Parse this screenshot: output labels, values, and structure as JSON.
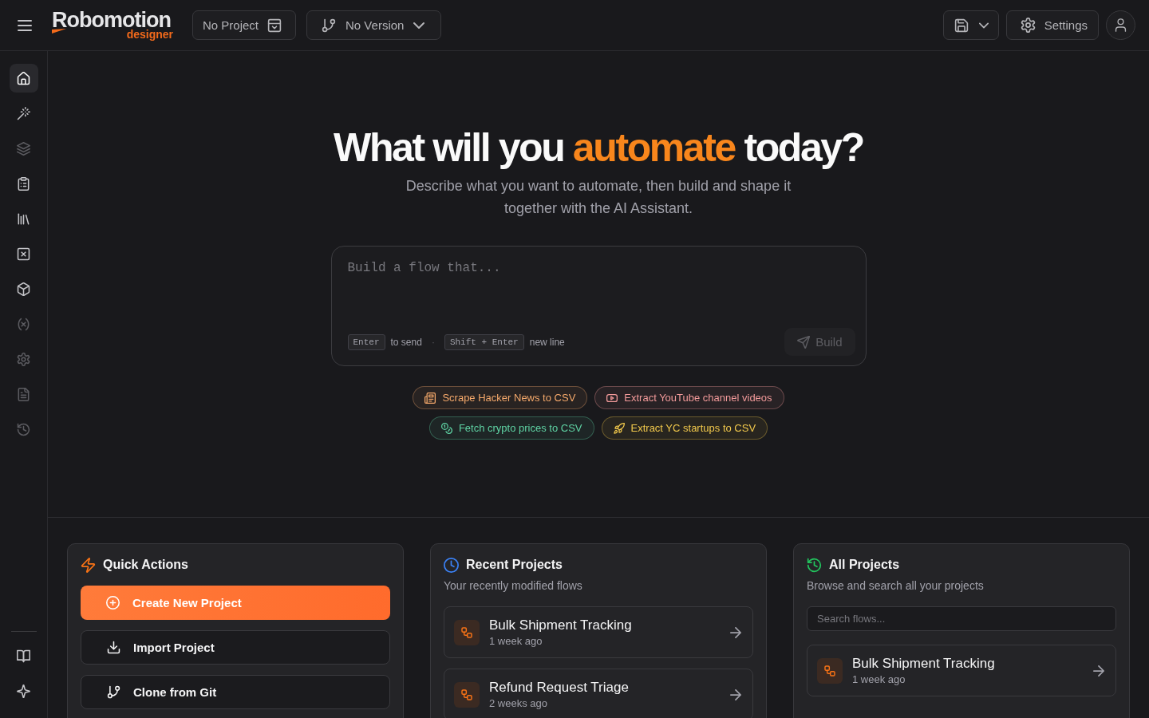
{
  "top_bar": {
    "wordmark": "Robomotion",
    "tagline": "designer",
    "project_picker": "No Project",
    "version_picker": "No Version",
    "settings_label": "Settings"
  },
  "sidebar": {
    "items": [
      {
        "selected": true,
        "disabled": false
      },
      {
        "selected": false,
        "disabled": false
      },
      {
        "selected": false,
        "disabled": true
      },
      {
        "selected": false,
        "disabled": false
      },
      {
        "selected": false,
        "disabled": false
      },
      {
        "selected": false,
        "disabled": false
      },
      {
        "selected": false,
        "disabled": false
      },
      {
        "selected": false,
        "disabled": true
      },
      {
        "selected": false,
        "disabled": true
      },
      {
        "selected": false,
        "disabled": true
      },
      {
        "selected": false,
        "disabled": true
      }
    ]
  },
  "hero": {
    "title": {
      "before": "What will you ",
      "highlight": "automate",
      "after": " today?"
    },
    "subtitle": "Describe what you want to automate, then build and shape it together with the AI Assistant.",
    "prompt": {
      "placeholder": "Build a flow that...",
      "hints": [
        {
          "key": "Enter",
          "text": "to send"
        },
        {
          "key": "Shift + Enter",
          "text": "new line"
        }
      ],
      "separator": "·",
      "build_button": {
        "label": "Build",
        "disabled": true
      }
    },
    "suggestions": [
      {
        "label": "Scrape Hacker News to CSV",
        "color": "#f5a96b"
      },
      {
        "label": "Extract YouTube channel videos",
        "color": "#f29a9a"
      },
      {
        "label": "Fetch crypto prices to CSV",
        "color": "#5fd3a4"
      },
      {
        "label": "Extract YC startups to CSV",
        "color": "#f2c94c"
      }
    ]
  },
  "cards": [
    {
      "kind": "actions",
      "title": "Quick Actions",
      "color": "#f97316",
      "actions": [
        {
          "label": "Create New Project",
          "primary": true
        },
        {
          "label": "Import Project",
          "primary": false
        },
        {
          "label": "Clone from Git",
          "primary": false
        }
      ]
    },
    {
      "kind": "recent",
      "title": "Recent Projects",
      "color": "#3b82f6",
      "subtitle": "Your recently modified flows",
      "items": [
        {
          "name": "Bulk Shipment Tracking",
          "time": "1 week ago"
        },
        {
          "name": "Refund Request Triage",
          "time": "2 weeks ago"
        }
      ]
    },
    {
      "kind": "all",
      "title": "All Projects",
      "color": "#22c55e",
      "subtitle": "Browse and search all your projects",
      "search": {
        "placeholder": "Search flows..."
      },
      "items": [
        {
          "name": "Bulk Shipment Tracking",
          "time": "1 week ago"
        }
      ]
    }
  ]
}
